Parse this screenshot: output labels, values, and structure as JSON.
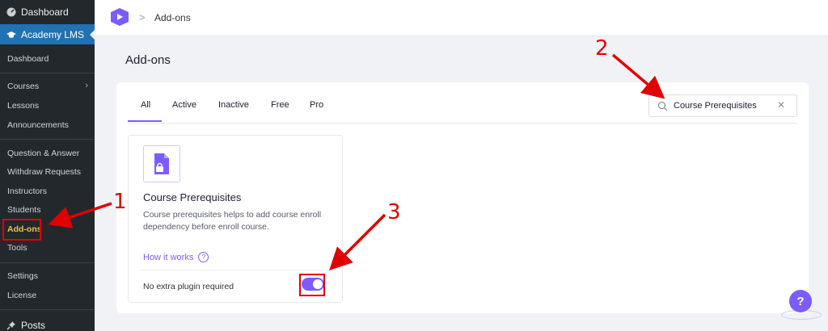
{
  "sidebar": {
    "top_item": "Dashboard",
    "lms_item": "Academy LMS",
    "items": [
      {
        "label": "Dashboard"
      },
      {
        "label": "Courses"
      },
      {
        "label": "Lessons"
      },
      {
        "label": "Announcements"
      },
      {
        "label": "Question & Answer"
      },
      {
        "label": "Withdraw Requests"
      },
      {
        "label": "Instructors"
      },
      {
        "label": "Students"
      },
      {
        "label": "Add-ons"
      },
      {
        "label": "Tools"
      },
      {
        "label": "Settings"
      },
      {
        "label": "License"
      }
    ],
    "posts_item": "Posts"
  },
  "header": {
    "breadcrumb": "Add-ons",
    "breadcrumb_sep": ">"
  },
  "page": {
    "title": "Add-ons"
  },
  "tabs": [
    "All",
    "Active",
    "Inactive",
    "Free",
    "Pro"
  ],
  "search": {
    "value": "Course Prerequisites",
    "clear": "✕"
  },
  "card": {
    "title": "Course Prerequisites",
    "description": "Course prerequisites helps to add course enroll dependency before enroll course.",
    "link": "How it works",
    "help": "?",
    "footer": "No extra plugin required",
    "enabled": true
  },
  "annotations": {
    "n1": "1",
    "n2": "2",
    "n3": "3"
  },
  "help_fab": "?",
  "colors": {
    "accent": "#7c5cff",
    "annotation": "#e10000",
    "sidebar_bg": "#23282d",
    "sidebar_active": "#2271b1",
    "active_text": "#f0c33c"
  }
}
